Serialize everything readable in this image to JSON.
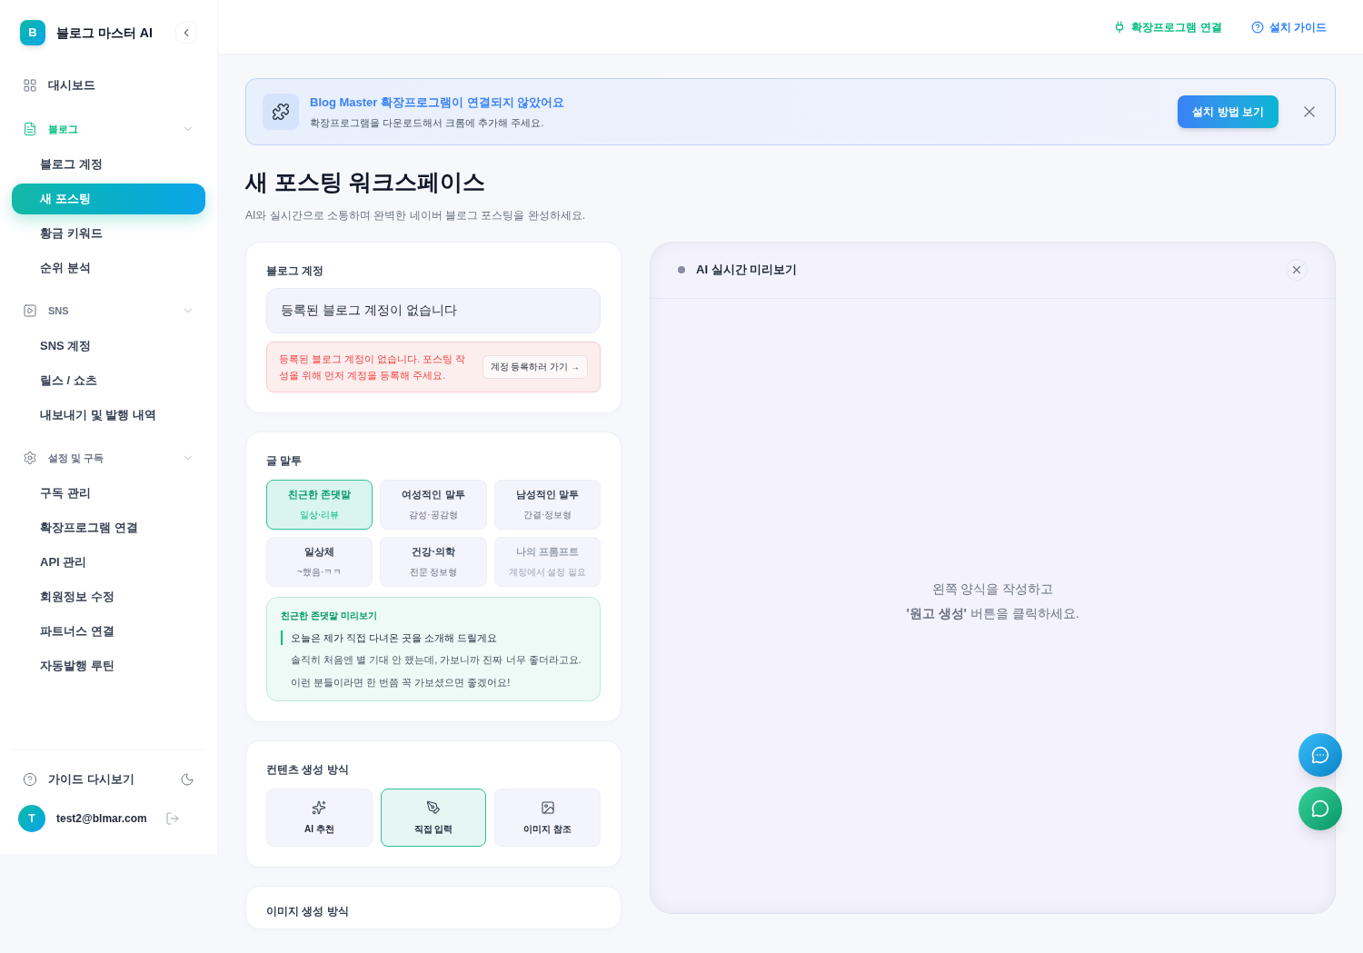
{
  "sidebar": {
    "logo_letter": "B",
    "title": "블로그 마스터 AI",
    "items": [
      {
        "label": "대시보드",
        "kind": "link"
      },
      {
        "label": "블로그",
        "kind": "group",
        "selected": true,
        "expanded": true,
        "children": [
          {
            "label": "블로그 계정",
            "selected": false
          },
          {
            "label": "새 포스팅",
            "selected": true
          },
          {
            "label": "황금 키워드",
            "selected": false
          },
          {
            "label": "순위 분석",
            "selected": false
          }
        ]
      },
      {
        "label": "SNS",
        "kind": "group",
        "selected": false,
        "expanded": true,
        "children": [
          {
            "label": "SNS 계정",
            "selected": false
          },
          {
            "label": "릴스 / 쇼츠",
            "selected": false
          },
          {
            "label": "내보내기 및 발행 내역",
            "selected": false
          }
        ]
      },
      {
        "label": "설정 및 구독",
        "kind": "group",
        "selected": false,
        "expanded": true,
        "children": [
          {
            "label": "구독 관리",
            "selected": false
          },
          {
            "label": "확장프로그램 연결",
            "selected": false
          },
          {
            "label": "API 관리",
            "selected": false
          },
          {
            "label": "회원정보 수정",
            "selected": false
          },
          {
            "label": "파트너스 연결",
            "selected": false
          },
          {
            "label": "자동발행 루틴",
            "selected": false
          }
        ]
      }
    ],
    "guide": "가이드 다시보기",
    "user": {
      "initial": "T",
      "email": "test2@blmar.com"
    }
  },
  "header": {
    "links": [
      {
        "label": "확장프로그램 연결",
        "kind": "plug"
      },
      {
        "label": "설치 가이드",
        "kind": "help"
      }
    ]
  },
  "banner": {
    "title": "Blog Master 확장프로그램이 연결되지 않았어요",
    "text": "확장프로그램을 다운로드해서 크롬에 추가해 주세요.",
    "button": "설치 방법 보기"
  },
  "page": {
    "title": "새 포스팅 워크스페이스",
    "subtitle": "AI와 실시간으로 소통하며 완벽한 네이버 블로그 포스팅을 완성하세요."
  },
  "account": {
    "label": "블로그 계정",
    "value": "등록된 블로그 계정이 없습니다",
    "alert": "등록된 블로그 계정이 없습니다. 포스팅 작성을 위해 먼저 계정을 등록해 주세요.",
    "alert_button": "계정 등록하러 가기 →"
  },
  "tone": {
    "label": "글 말투",
    "options": [
      {
        "label": "친근한 존댓말",
        "sub": "일상·리뷰",
        "selected": true,
        "disabled": false
      },
      {
        "label": "여성적인 말투",
        "sub": "감성·공감형",
        "selected": false,
        "disabled": false
      },
      {
        "label": "남성적인 말투",
        "sub": "간결·정보형",
        "selected": false,
        "disabled": false
      },
      {
        "label": "일상체",
        "sub": "~했음·ㅋㅋ",
        "selected": false,
        "disabled": false
      },
      {
        "label": "건강·의학",
        "sub": "전문 정보형",
        "selected": false,
        "disabled": false
      },
      {
        "label": "나의 프롬프트",
        "sub": "계정에서 설정 필요",
        "selected": false,
        "disabled": true
      }
    ],
    "preview": {
      "title": "친근한 존댓말 미리보기",
      "lines": [
        "오늘은 제가 직접 다녀온 곳을 소개해 드릴게요",
        "솔직히 처음엔 별 기대 안 했는데, 가보니까 진짜 너무 좋더라고요.",
        "이런 분들이라면 한 번쯤 꼭 가보셨으면 좋겠어요!"
      ]
    }
  },
  "method": {
    "label": "컨텐츠 생성 방식",
    "options": [
      {
        "label": "AI 추천",
        "kind": "sparkle",
        "selected": false
      },
      {
        "label": "직접 입력",
        "kind": "pen",
        "selected": true
      },
      {
        "label": "이미지 참조",
        "kind": "image",
        "selected": false
      }
    ]
  },
  "image_method": {
    "label": "이미지 생성 방식"
  },
  "preview_panel": {
    "title": "AI 실시간 미리보기",
    "hint_lines": [
      "왼쪽 양식을 작성하고",
      "**'원고 생성'** 버튼을 클릭하세요."
    ]
  }
}
